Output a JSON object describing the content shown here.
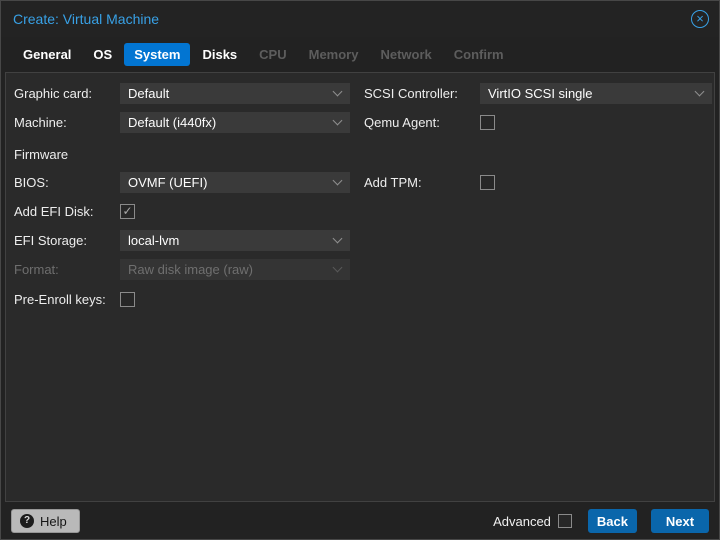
{
  "window": {
    "title": "Create: Virtual Machine"
  },
  "icons": {
    "close_glyph": "×",
    "help_glyph": "?",
    "check_glyph": "✓"
  },
  "tabs": [
    {
      "label": "General",
      "state": "enabled"
    },
    {
      "label": "OS",
      "state": "enabled"
    },
    {
      "label": "System",
      "state": "active"
    },
    {
      "label": "Disks",
      "state": "enabled"
    },
    {
      "label": "CPU",
      "state": "disabled"
    },
    {
      "label": "Memory",
      "state": "disabled"
    },
    {
      "label": "Network",
      "state": "disabled"
    },
    {
      "label": "Confirm",
      "state": "disabled"
    }
  ],
  "form": {
    "left": {
      "graphic_card": {
        "label": "Graphic card:",
        "value": "Default",
        "type": "dropdown"
      },
      "machine": {
        "label": "Machine:",
        "value": "Default (i440fx)",
        "type": "dropdown"
      },
      "firmware_heading": "Firmware",
      "bios": {
        "label": "BIOS:",
        "value": "OVMF (UEFI)",
        "type": "dropdown"
      },
      "add_efi_disk": {
        "label": "Add EFI Disk:",
        "checked": true,
        "mark": "✓",
        "type": "checkbox"
      },
      "efi_storage": {
        "label": "EFI Storage:",
        "value": "local-lvm",
        "type": "dropdown"
      },
      "format": {
        "label": "Format:",
        "value": "Raw disk image (raw)",
        "type": "dropdown",
        "disabled": true
      },
      "pre_enroll_keys": {
        "label": "Pre-Enroll keys:",
        "checked": false,
        "type": "checkbox"
      }
    },
    "right": {
      "scsi_controller": {
        "label": "SCSI Controller:",
        "value": "VirtIO SCSI single",
        "type": "dropdown"
      },
      "qemu_agent": {
        "label": "Qemu Agent:",
        "checked": false,
        "type": "checkbox"
      },
      "add_tpm": {
        "label": "Add TPM:",
        "checked": false,
        "type": "checkbox"
      }
    }
  },
  "footer": {
    "help_label": "Help",
    "advanced_label": "Advanced",
    "advanced_checked": false,
    "back_label": "Back",
    "next_label": "Next"
  },
  "colors": {
    "title_blue": "#38a1e6",
    "active_tab_blue": "#0275d2",
    "button_blue": "#0a66ab",
    "panel_bg": "#2a2a2a",
    "field_bg": "#3a3a3a",
    "help_button_bg": "#b9b9b9"
  }
}
